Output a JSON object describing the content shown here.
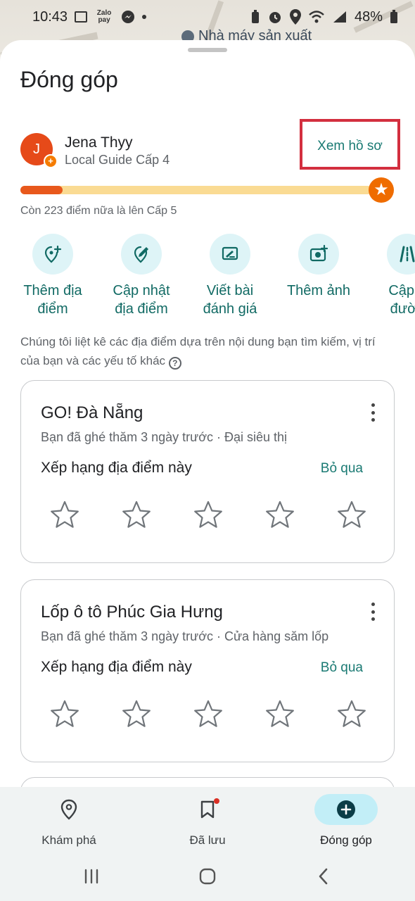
{
  "status_bar": {
    "time": "10:43",
    "zalopay": "Zalo pay",
    "battery": "48%",
    "icons": [
      "image-icon",
      "zalopay-icon",
      "messenger-icon",
      "dot-icon",
      "battery-saver-icon",
      "alarm-icon",
      "location-icon",
      "wifi-icon",
      "volte-icon",
      "signal-icon",
      "battery-icon"
    ]
  },
  "map": {
    "poi_label": "Nhà máy sản xuất"
  },
  "sheet": {
    "title": "Đóng góp",
    "profile": {
      "avatar_letter": "J",
      "name": "Jena Thyy",
      "level": "Local Guide Cấp 4",
      "view_profile": "Xem hồ sơ"
    },
    "progress": {
      "fraction": 0.12,
      "note": "Còn 223 điểm nữa là lên Cấp 5"
    },
    "actions": [
      {
        "label": "Thêm địa\nđiểm",
        "icon": "add-place-icon"
      },
      {
        "label": "Cập nhật\nđịa điểm",
        "icon": "edit-place-icon"
      },
      {
        "label": "Viết bài\nđánh giá",
        "icon": "write-review-icon"
      },
      {
        "label": "Thêm ảnh",
        "icon": "add-photo-icon"
      },
      {
        "label": "Cập n\nđườn",
        "icon": "update-road-icon"
      }
    ],
    "disclaimer": "Chúng tôi liệt kê các địa điểm dựa trên nội dung bạn tìm kiếm, vị trí của bạn và các yếu tố khác",
    "cards": [
      {
        "name": "GO! Đà Nẵng",
        "meta": "Bạn đã ghé thăm 3 ngày trước · Đại siêu thị",
        "prompt": "Xếp hạng địa điểm này",
        "skip": "Bỏ qua",
        "rating": 0,
        "max_rating": 5
      },
      {
        "name": "Lốp ô tô Phúc Gia Hưng",
        "meta": "Bạn đã ghé thăm 3 ngày trước · Cửa hàng săm lốp",
        "prompt": "Xếp hạng địa điểm này",
        "skip": "Bỏ qua",
        "rating": 0,
        "max_rating": 5
      }
    ]
  },
  "bottom_nav": [
    {
      "label": "Khám phá",
      "icon": "explore-pin-icon",
      "active": false
    },
    {
      "label": "Đã lưu",
      "icon": "saved-bookmark-icon",
      "active": false,
      "has_notification": true
    },
    {
      "label": "Đóng góp",
      "icon": "contribute-plus-icon",
      "active": true
    }
  ],
  "system_nav": [
    "recent-apps-icon",
    "home-icon",
    "back-icon"
  ],
  "colors": {
    "accent_teal": "#1a7a73",
    "highlight_box": "#d32f3f",
    "progress_fill": "#e8581c",
    "progress_track": "#fadb93",
    "action_bg": "#def4f7",
    "nav_active_bg": "#c2eef7"
  }
}
